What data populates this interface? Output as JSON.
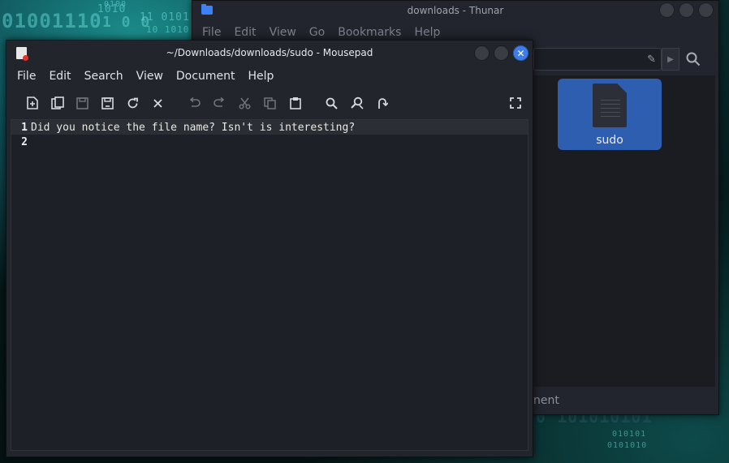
{
  "thunar": {
    "title": "downloads - Thunar",
    "menu": [
      "File",
      "Edit",
      "View",
      "Go",
      "Bookmarks",
      "Help"
    ],
    "file_name": "sudo",
    "status_fragment": "nent"
  },
  "mousepad": {
    "title": "~/Downloads/downloads/sudo - Mousepad",
    "menu": [
      "File",
      "Edit",
      "Search",
      "View",
      "Document",
      "Help"
    ],
    "close_glyph": "✕",
    "lines": [
      {
        "num": "1",
        "text": "Did you notice the file name? Isn't is interesting?"
      },
      {
        "num": "2",
        "text": ""
      }
    ],
    "toolbar_icons": [
      "new-document-icon",
      "new-window-icon",
      "save-icon",
      "save-as-icon",
      "reload-icon",
      "close-tab-icon",
      "undo-icon",
      "redo-icon",
      "cut-icon",
      "copy-icon",
      "paste-icon",
      "find-icon",
      "find-replace-icon",
      "goto-line-icon",
      "fullscreen-icon"
    ]
  },
  "wallpaper": {
    "binary_rows": [
      "01001110",
      "1010",
      "11 0101",
      "1 0 0",
      "0100",
      "10 1010"
    ],
    "binary_bottom": [
      "0  101010101",
      "010101",
      "0101010"
    ]
  },
  "colors": {
    "accent": "#3d7ee8",
    "selection": "#2d5eb0",
    "window_bg": "#23252d",
    "editor_bg": "#1e2027"
  }
}
